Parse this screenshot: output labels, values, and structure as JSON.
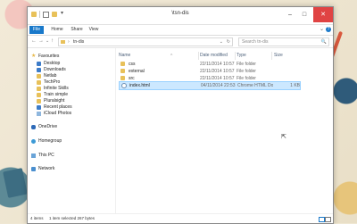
{
  "window": {
    "title": "\\tsn-dis",
    "controls": {
      "minimize": "–",
      "maximize": "□",
      "close": "✕"
    }
  },
  "ribbon": {
    "tabs": [
      "File",
      "Home",
      "Share",
      "View"
    ],
    "expand_icon": "chevron-down-icon",
    "help": "?"
  },
  "address": {
    "path_separator": "›",
    "path": "tn-dis",
    "chevron": "⌄",
    "refresh": "↻"
  },
  "search": {
    "placeholder": "Search tn-dis",
    "icon": "🔍"
  },
  "nav": {
    "back": "←",
    "forward": "→",
    "recent": "⌄",
    "up": "↑",
    "favorites_label": "Favourites",
    "favorites": [
      "Desktop",
      "Downloads",
      "Netlab",
      "TechPro",
      "Infinite Skills",
      "Train simple",
      "Pluralsight",
      "Recent places",
      "iCloud Photos"
    ],
    "onedrive": "OneDrive",
    "homegroup": "Homegroup",
    "thispc": "This PC",
    "network": "Network"
  },
  "columns": {
    "name": "Name",
    "date": "Date modified",
    "type": "Type",
    "size": "Size",
    "sort_arrow": "^"
  },
  "files": [
    {
      "name": "css",
      "date": "22/11/2014 10:57",
      "type": "File folder",
      "size": ""
    },
    {
      "name": "external",
      "date": "22/11/2014 10:57",
      "type": "File folder",
      "size": ""
    },
    {
      "name": "src",
      "date": "22/11/2014 10:57",
      "type": "File folder",
      "size": ""
    },
    {
      "name": "index.html",
      "date": "04/11/2014 22:53",
      "type": "Chrome HTML Do...",
      "size": "1 KB",
      "selected": true
    }
  ],
  "status": {
    "items": "4 items",
    "selected": "1 item selected  267 bytes"
  },
  "colors": {
    "accent": "#1979ca",
    "selection": "#cce8ff",
    "folder": "#e8c15a",
    "close": "#e04343"
  }
}
